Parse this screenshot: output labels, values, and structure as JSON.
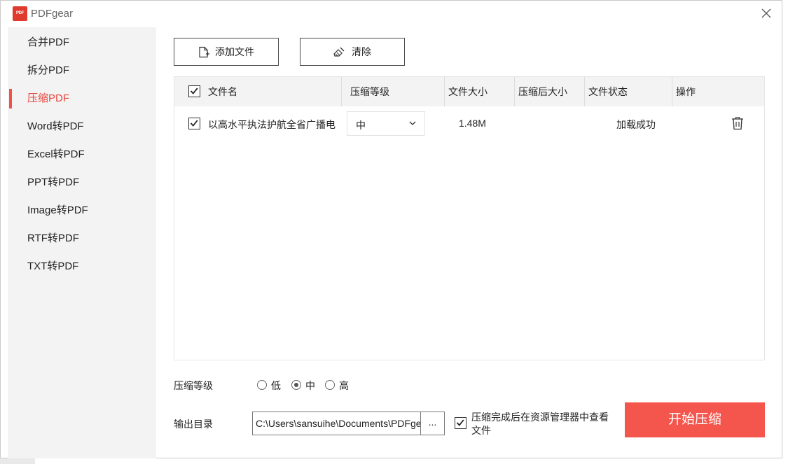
{
  "app": {
    "logo_text": "PDF",
    "title": "PDFgear"
  },
  "sidebar": {
    "items": [
      {
        "label": "合并PDF",
        "active": false
      },
      {
        "label": "拆分PDF",
        "active": false
      },
      {
        "label": "压缩PDF",
        "active": true
      },
      {
        "label": "Word转PDF",
        "active": false
      },
      {
        "label": "Excel转PDF",
        "active": false
      },
      {
        "label": "PPT转PDF",
        "active": false
      },
      {
        "label": "Image转PDF",
        "active": false
      },
      {
        "label": "RTF转PDF",
        "active": false
      },
      {
        "label": "TXT转PDF",
        "active": false
      }
    ]
  },
  "toolbar": {
    "add_label": "添加文件",
    "clear_label": "清除"
  },
  "table": {
    "headers": {
      "name": "文件名",
      "level": "压缩等级",
      "size": "文件大小",
      "compressed_size": "压缩后大小",
      "status": "文件状态",
      "action": "操作"
    },
    "rows": [
      {
        "checked": true,
        "name": "以高水平执法护航全省广播电",
        "level": "中",
        "size": "1.48M",
        "compressed_size": "",
        "status": "加载成功"
      }
    ]
  },
  "compression": {
    "label": "压缩等级",
    "options": [
      "低",
      "中",
      "高"
    ],
    "selected": "中"
  },
  "output": {
    "label": "输出目录",
    "path": "C:\\Users\\sansuihe\\Documents\\PDFgear",
    "browse_label": "...",
    "open_after_checked": true,
    "open_after_label": "压缩完成后在资源管理器中查看文件"
  },
  "start_label": "开始压缩",
  "colors": {
    "accent": "#f4554c",
    "active_text": "#e8453c",
    "sidebar_bg": "#f3f3f3"
  }
}
